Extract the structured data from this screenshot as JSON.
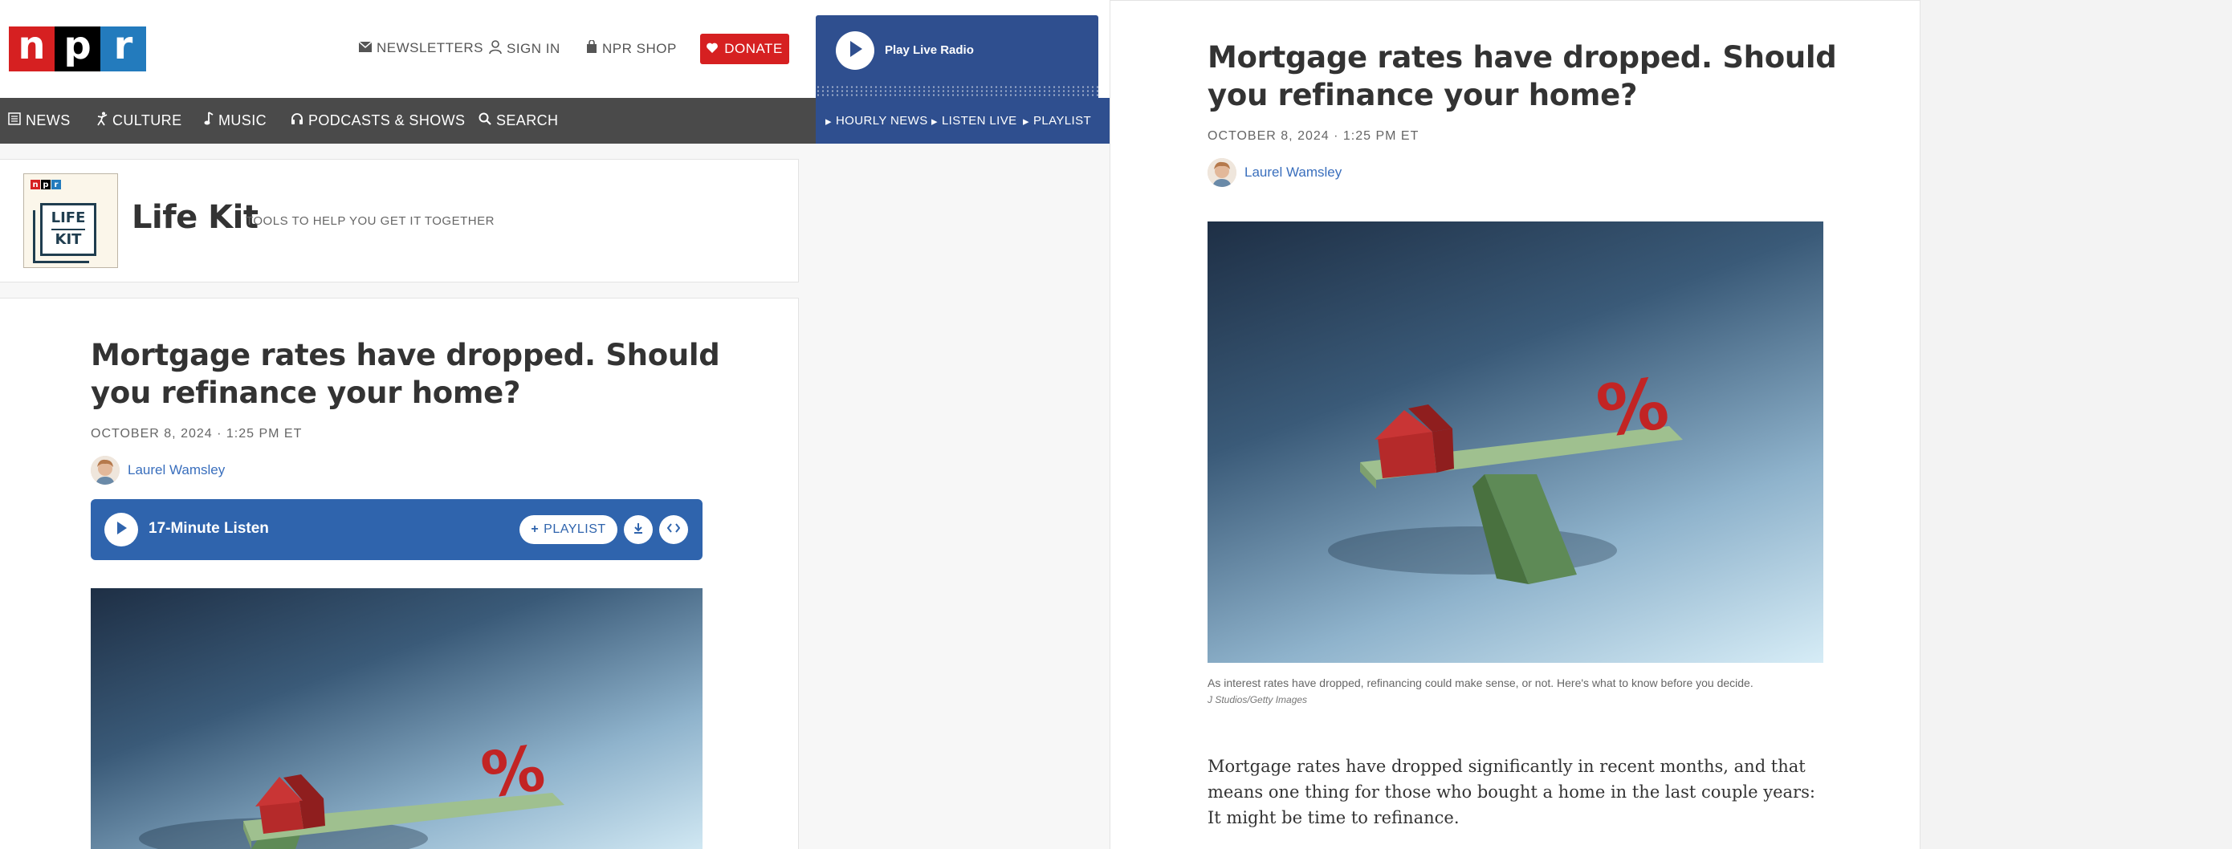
{
  "header": {
    "logo_letters": [
      "n",
      "p",
      "r"
    ],
    "newsletters": "NEWSLETTERS",
    "sign_in": "SIGN IN",
    "shop": "NPR SHOP",
    "donate": "DONATE"
  },
  "player": {
    "label": "Play Live Radio",
    "links": [
      "HOURLY NEWS",
      "LISTEN LIVE",
      "PLAYLIST"
    ]
  },
  "nav": {
    "items": [
      "NEWS",
      "CULTURE",
      "MUSIC",
      "PODCASTS & SHOWS",
      "SEARCH"
    ]
  },
  "lifekit": {
    "logo_line1": "LIFE",
    "logo_line2": "KIT",
    "title": "Life Kit",
    "tagline": "TOOLS TO HELP YOU GET IT TOGETHER"
  },
  "article": {
    "title": "Mortgage rates have dropped. Should you refinance your home?",
    "date": "OCTOBER 8, 2024 · 1:25 PM ET",
    "author": "Laurel Wamsley",
    "audio_label": "17-Minute Listen",
    "playlist_label": "PLAYLIST",
    "caption": "As interest rates have dropped, refinancing could make sense, or not. Here's what to know before you decide.",
    "credit": "J Studios/Getty Images",
    "body": "Mortgage rates have dropped significantly in recent months, and that means one thing for those who bought a home in the last couple years: It might be time to refinance."
  },
  "colors": {
    "npr_red": "#d62021",
    "npr_blue": "#237bbd",
    "player_blue": "#2f4f8f",
    "audio_blue": "#2f64ad",
    "author_link": "#3a6fbd"
  }
}
